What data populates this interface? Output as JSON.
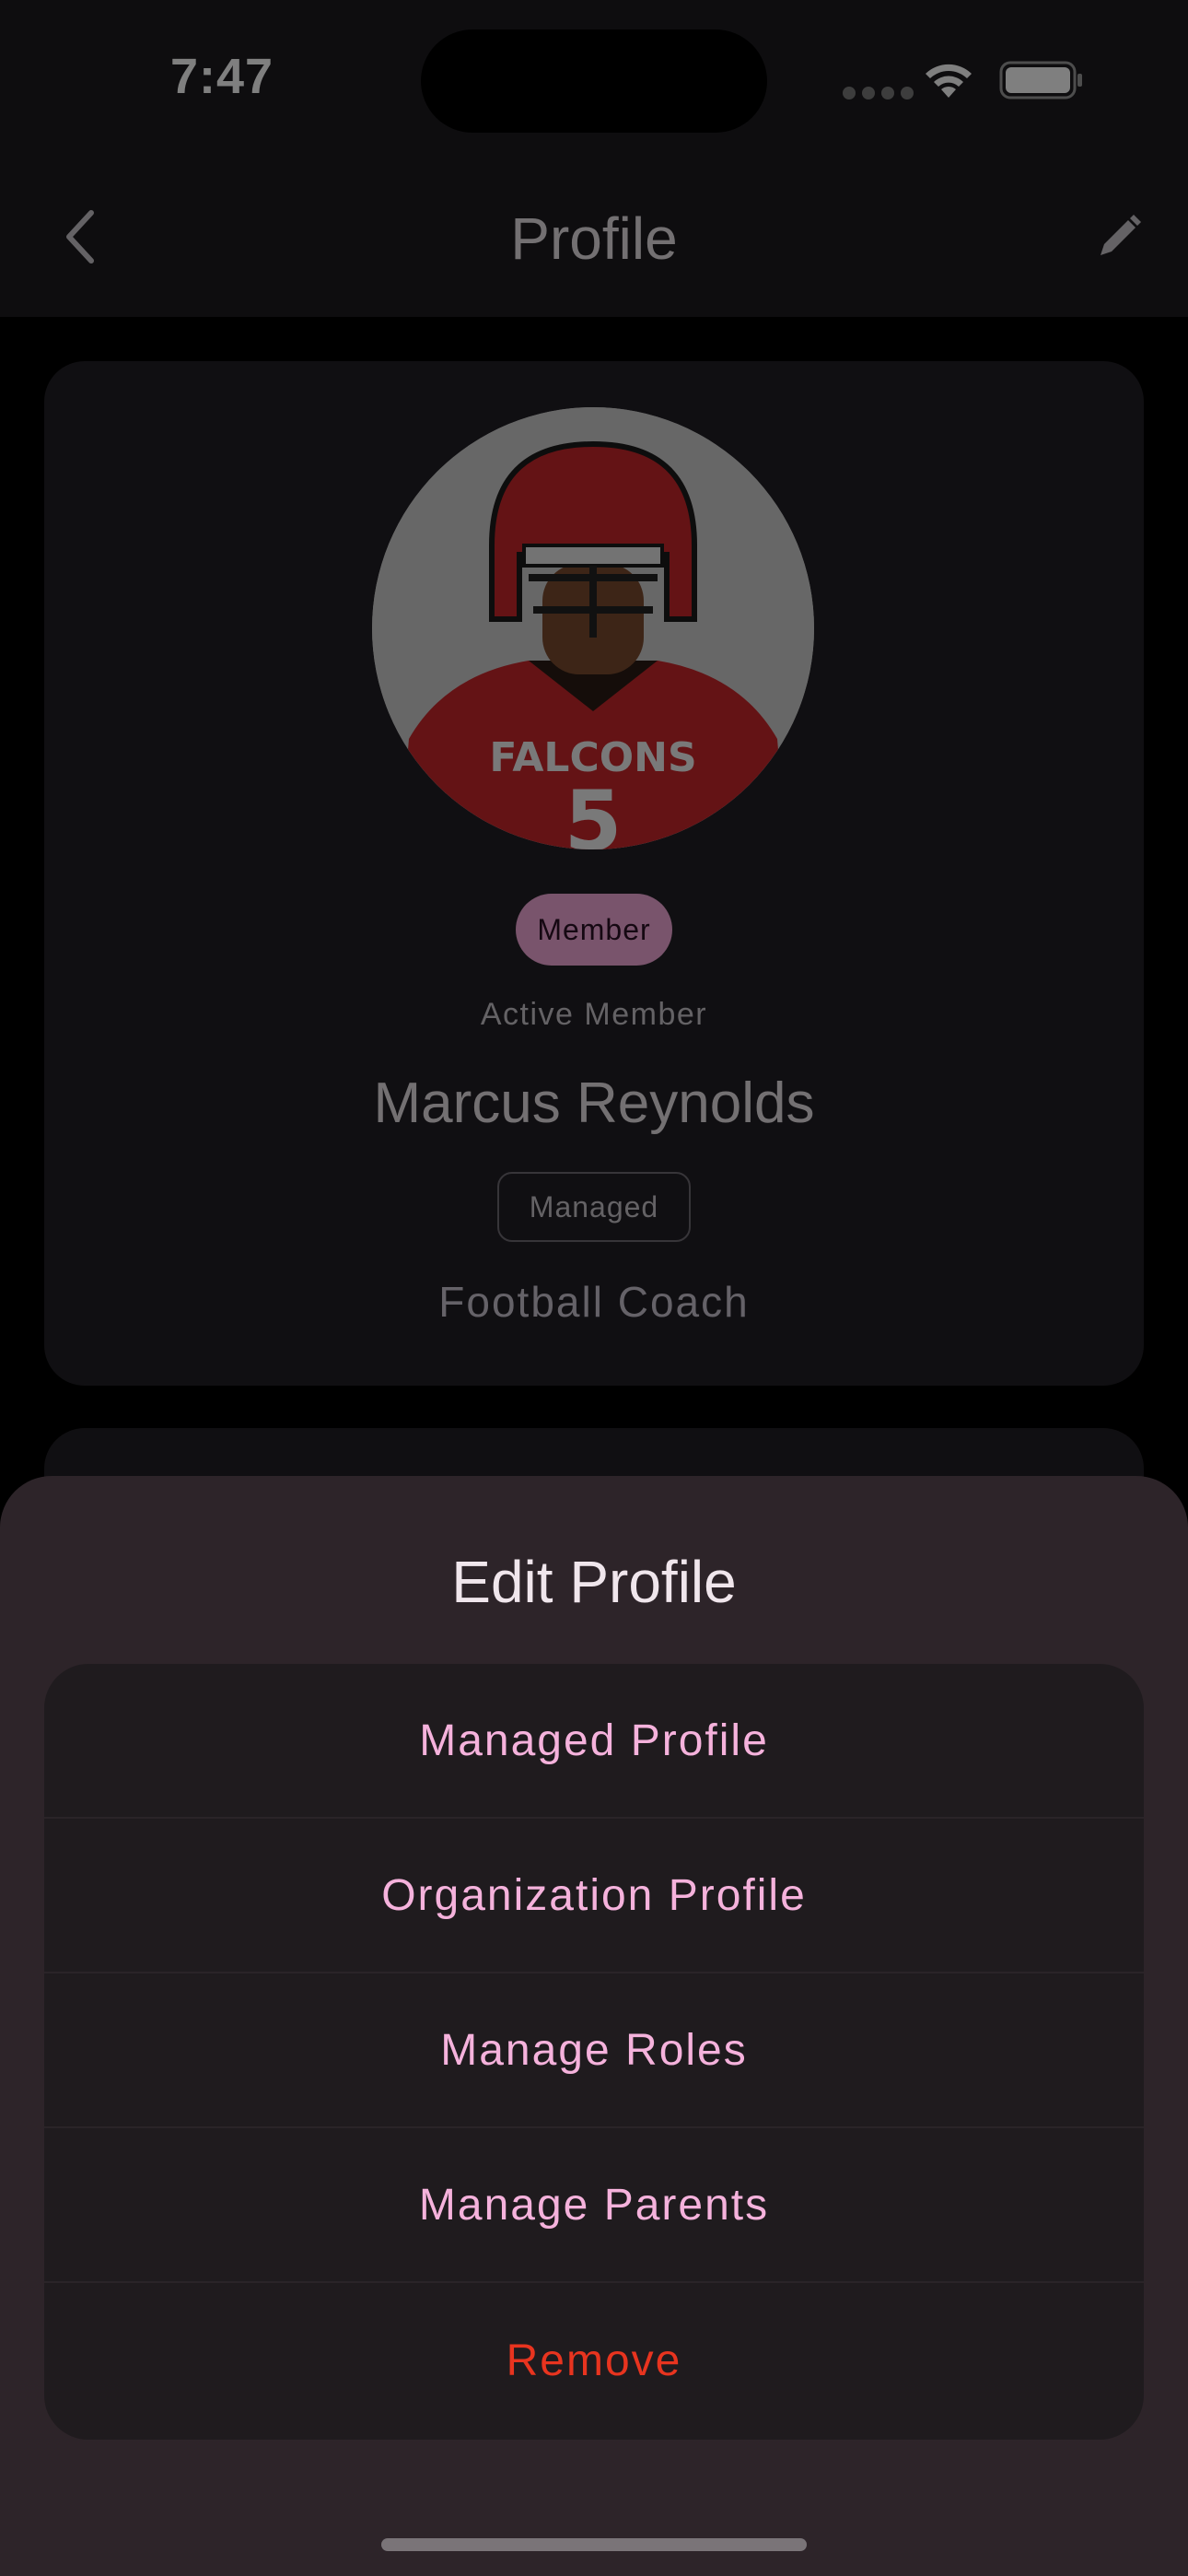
{
  "status_bar": {
    "time": "7:47"
  },
  "app_bar": {
    "title": "Profile"
  },
  "profile": {
    "chip": "Member",
    "status": "Active Member",
    "name": "Marcus Reynolds",
    "managed_badge": "Managed",
    "role_title": "Football Coach",
    "avatar_jersey_text": "FALCONS",
    "avatar_jersey_number": "5"
  },
  "sheet": {
    "title": "Edit Profile",
    "actions": [
      {
        "label": "Managed Profile"
      },
      {
        "label": "Organization Profile"
      },
      {
        "label": "Manage Roles"
      },
      {
        "label": "Manage Parents"
      },
      {
        "label": "Remove"
      }
    ]
  },
  "colors": {
    "accent_pink": "#f5b2dc",
    "destructive_red": "#e8341f",
    "sheet_bg": "#2d2429"
  },
  "icons": [
    "back-chevron-icon",
    "edit-pencil-icon",
    "wifi-icon",
    "battery-icon",
    "cellular-signal-icon"
  ]
}
